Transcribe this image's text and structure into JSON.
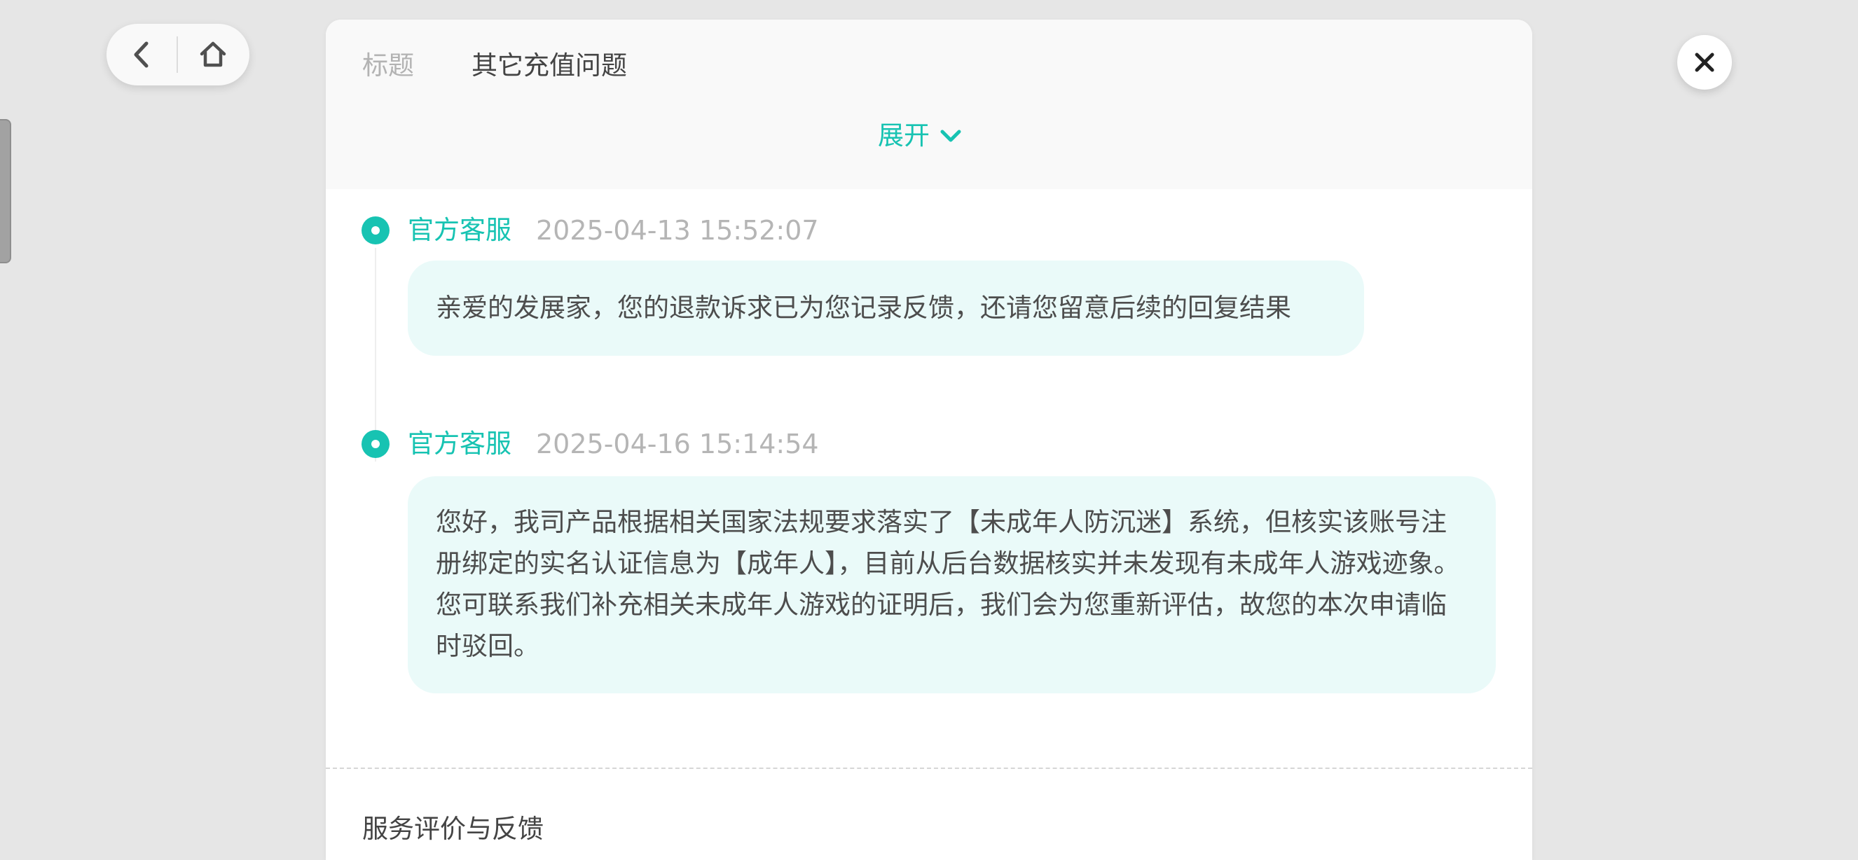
{
  "nav": {
    "back_icon": "chevron-left-icon",
    "home_icon": "home-outline-icon"
  },
  "close_icon": "close-icon",
  "header": {
    "title_label": "标题",
    "title_value": "其它充值问题",
    "expand_label": "展开",
    "expand_icon": "chevron-down-icon"
  },
  "messages": [
    {
      "sender": "官方客服",
      "time": "2025-04-13 15:52:07",
      "text": "亲爱的发展家，您的退款诉求已为您记录反馈，还请您留意后续的回复结果"
    },
    {
      "sender": "官方客服",
      "time": "2025-04-16 15:14:54",
      "text": "您好，我司产品根据相关国家法规要求落实了【未成年人防沉迷】系统，但核实该账号注册绑定的实名认证信息为【成年人】，目前从后台数据核实并未发现有未成年人游戏迹象。您可联系我们补充相关未成年人游戏的证明后，我们会为您重新评估，故您的本次申请临时驳回。"
    }
  ],
  "footer": {
    "section_label": "服务评价与反馈"
  },
  "colors": {
    "accent": "#17c3b2",
    "bubble_bg": "#eafaf9",
    "page_bg": "#e6e6e6"
  }
}
